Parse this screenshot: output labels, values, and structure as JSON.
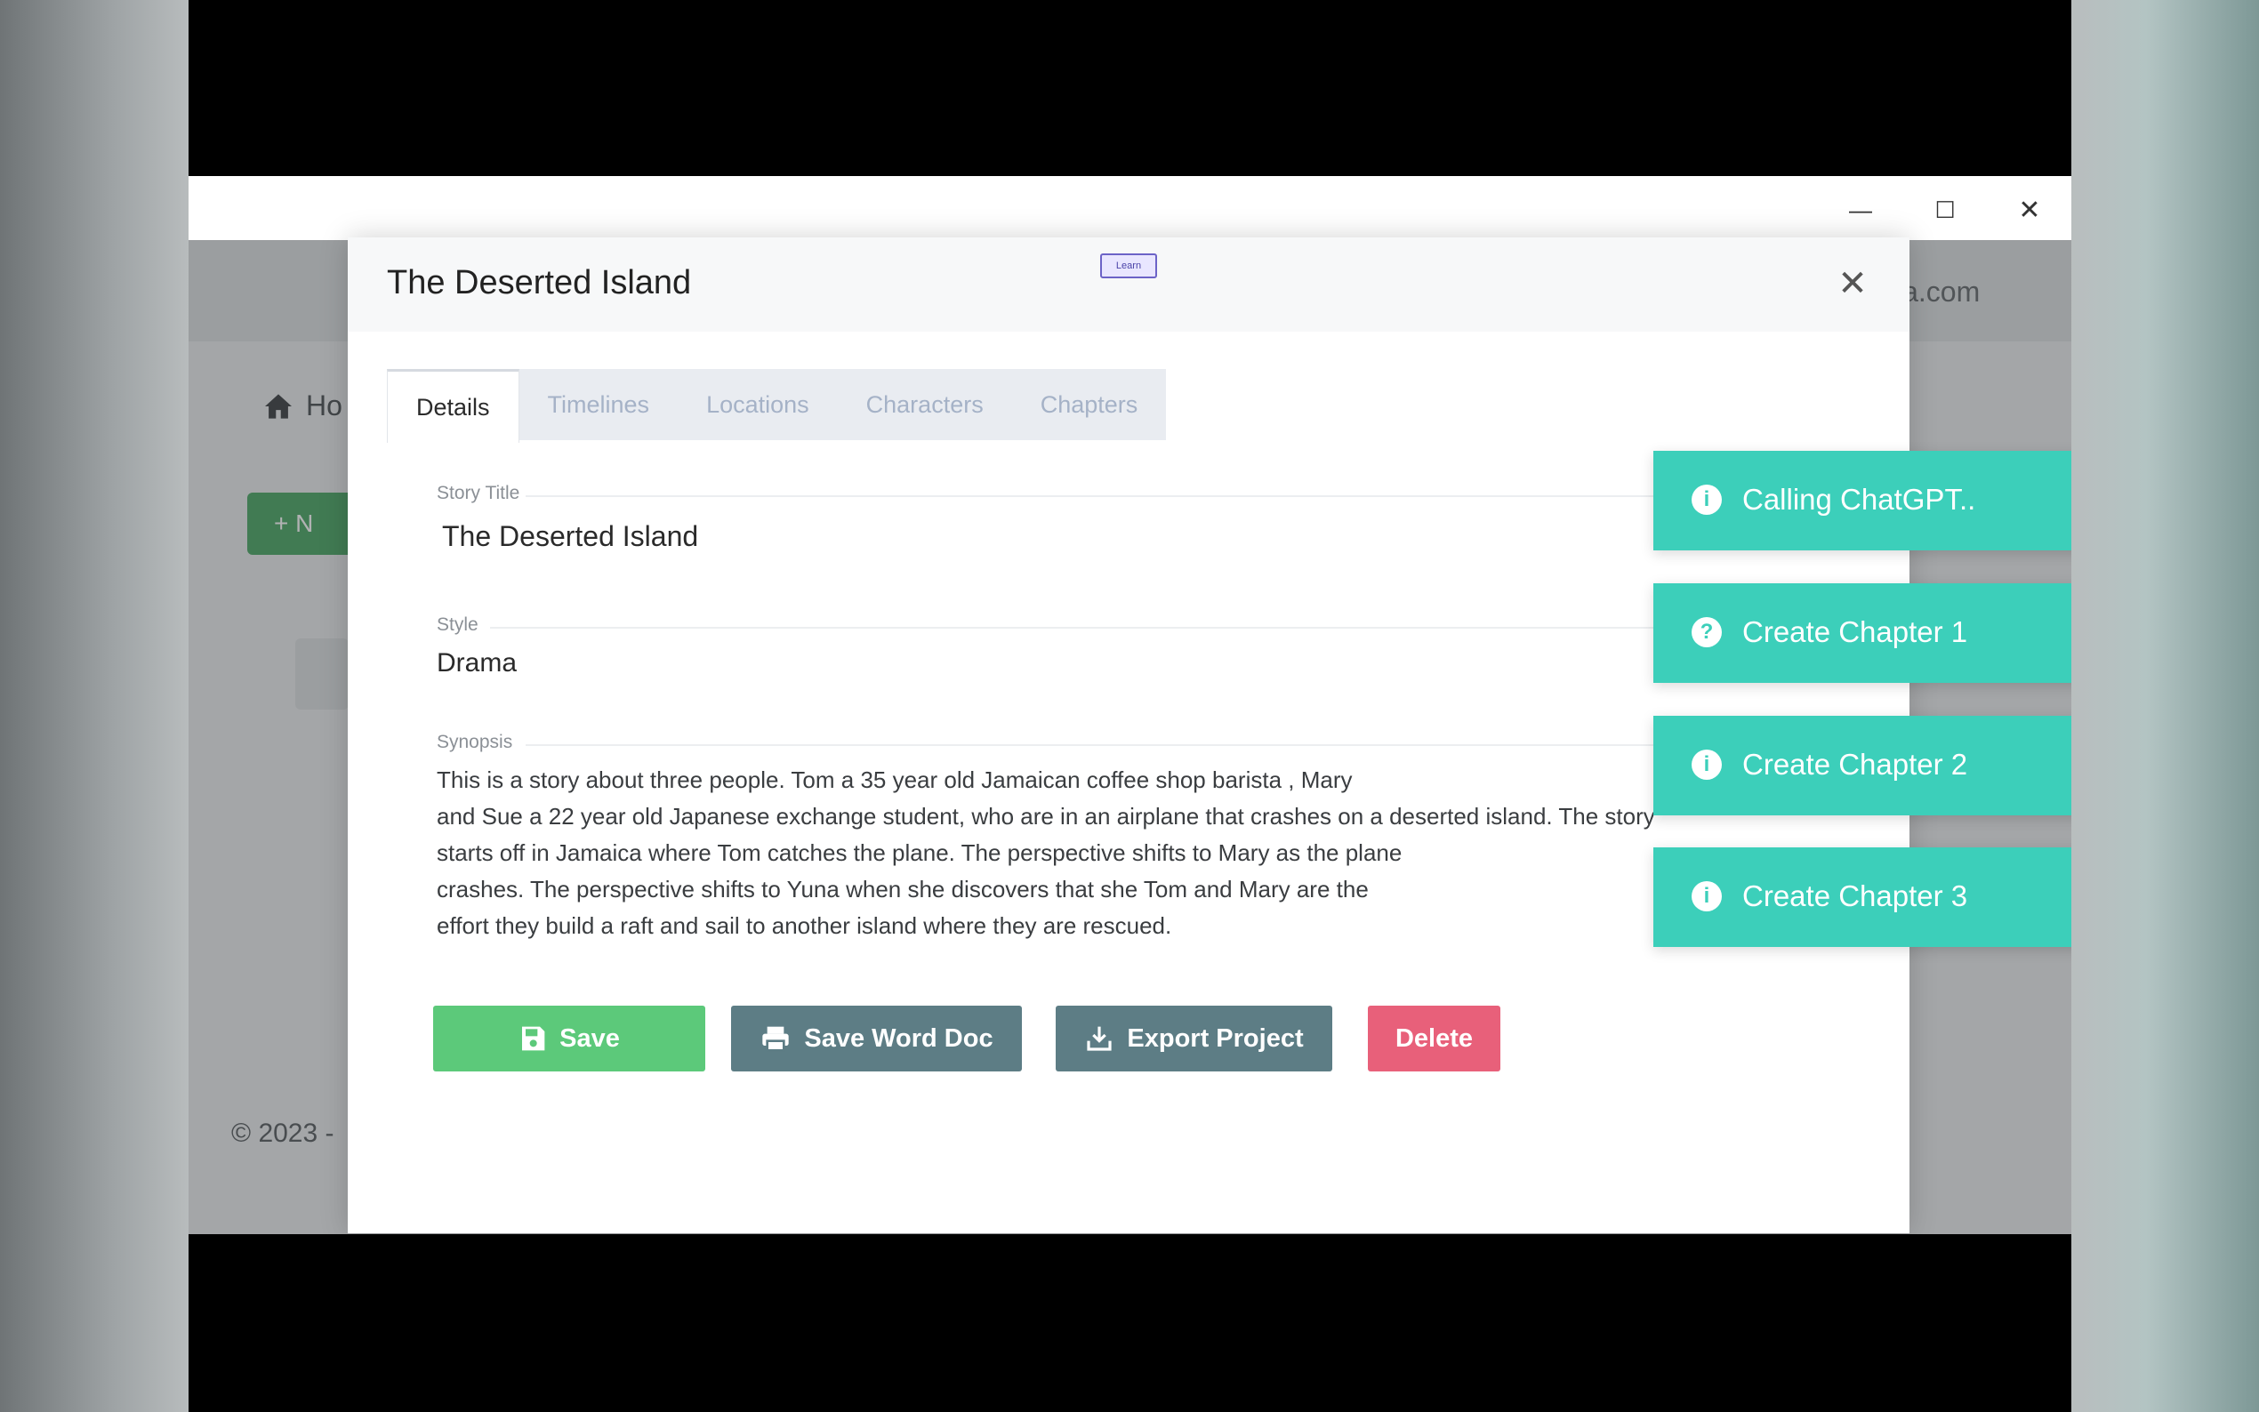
{
  "window": {
    "minimize_glyph": "—",
    "maximize_glyph": "☐",
    "close_glyph": "✕"
  },
  "background_app": {
    "header_email_fragment": "la.com",
    "breadcrumb_home": "Ho",
    "new_button_fragment": "+ N",
    "copyright_fragment": "© 2023 -"
  },
  "modal": {
    "title": "The Deserted Island",
    "close_glyph": "✕",
    "badge_text": "Learn"
  },
  "tabs": [
    {
      "label": "Details",
      "active": true
    },
    {
      "label": "Timelines",
      "active": false
    },
    {
      "label": "Locations",
      "active": false
    },
    {
      "label": "Characters",
      "active": false
    },
    {
      "label": "Chapters",
      "active": false
    }
  ],
  "form": {
    "story_title": {
      "label": "Story Title",
      "value": "The Deserted Island"
    },
    "style": {
      "label": "Style",
      "value": "Drama"
    },
    "synopsis": {
      "label": "Synopsis",
      "lines": [
        "This is a story about three people. Tom a 35 year old Jamaican coffee shop barista , Mary",
        "and Sue a 22 year old Japanese exchange student, who are in an airplane that crashes on a deserted island. The story",
        "starts off in Jamaica where Tom catches the plane. The perspective shifts to Mary as the plane",
        "crashes. The perspective shifts to Yuna when she discovers that she Tom and Mary are the",
        "effort they build a raft and sail to another island where they are rescued."
      ]
    }
  },
  "buttons": {
    "save": "Save",
    "save_word": "Save Word Doc",
    "export": "Export Project",
    "delete": "Delete"
  },
  "toasts": [
    {
      "icon": "info-icon",
      "glyph": "i",
      "message": "Calling ChatGPT..",
      "close": "✕"
    },
    {
      "icon": "help-icon",
      "glyph": "?",
      "message": "Create Chapter 1",
      "close": "✕"
    },
    {
      "icon": "info-icon",
      "glyph": "i",
      "message": "Create Chapter 2",
      "close": "✕"
    },
    {
      "icon": "info-icon",
      "glyph": "i",
      "message": "Create Chapter 3",
      "close": "✕"
    }
  ],
  "colors": {
    "toast_bg": "#3ccfba",
    "save_button": "#5cc97a",
    "secondary_button": "#5d7d85",
    "delete_button": "#e8607a"
  }
}
